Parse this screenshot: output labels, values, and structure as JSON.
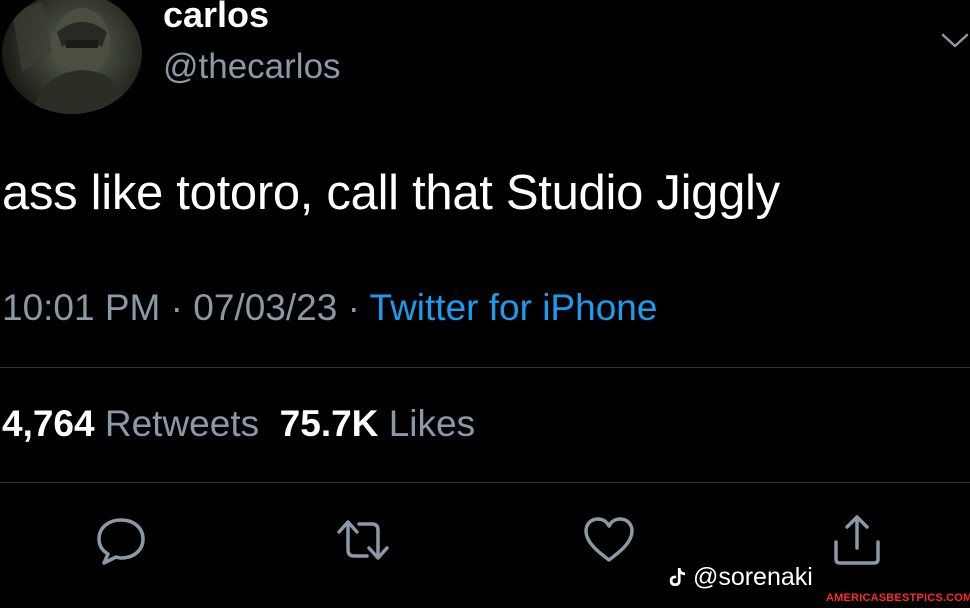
{
  "tweet": {
    "display_name": "carlos",
    "handle": "@thecarlos",
    "text": "ass like totoro, call that Studio Jiggly",
    "time": "10:01 PM",
    "date": "07/03/23",
    "separator": " · ",
    "source": "Twitter for iPhone",
    "retweets_count": "4,764",
    "retweets_label": "Retweets",
    "likes_count": "75.7K",
    "likes_label": "Likes"
  },
  "icons": {
    "more": "chevron-down-icon",
    "reply": "reply-icon",
    "retweet": "retweet-icon",
    "like": "heart-icon",
    "share": "share-icon",
    "tiktok": "tiktok-icon"
  },
  "watermark": {
    "tiktok_user": "@sorenaki",
    "site": "AMERICASBESTPICS.COM"
  },
  "colors": {
    "background": "#000000",
    "primary_text": "#ffffff",
    "secondary_text": "#8b98a5",
    "link": "#1d9bf0",
    "divider": "#2f3336",
    "site_badge": "#ff2a2a"
  }
}
